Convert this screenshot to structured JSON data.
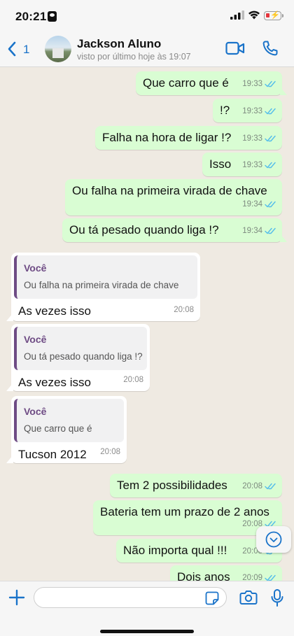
{
  "status_bar": {
    "time": "20:21"
  },
  "header": {
    "back_count": "1",
    "contact_name": "Jackson Aluno",
    "contact_status": "visto por último hoje às 19:07"
  },
  "messages": [
    {
      "text": "Que carro que é",
      "time": "19:33",
      "outgoing": true,
      "read": true
    },
    {
      "text": "!?",
      "time": "19:33",
      "outgoing": true,
      "read": true
    },
    {
      "text": "Falha na hora de ligar !?",
      "time": "19:33",
      "outgoing": true,
      "read": true
    },
    {
      "text": "Isso",
      "time": "19:33",
      "outgoing": true,
      "read": true
    },
    {
      "text": "Ou falha na primeira virada de chave",
      "time": "19:34",
      "outgoing": true,
      "read": true
    },
    {
      "text": "Ou tá pesado quando liga !?",
      "time": "19:34",
      "outgoing": true,
      "read": true
    },
    {
      "text": "As vezes isso",
      "time": "20:08",
      "outgoing": false,
      "quote": {
        "author": "Você",
        "text": "Ou falha na primeira virada de chave"
      }
    },
    {
      "text": "As vezes isso",
      "time": "20:08",
      "outgoing": false,
      "quote": {
        "author": "Você",
        "text": "Ou tá pesado quando liga !?"
      }
    },
    {
      "text": "Tucson 2012",
      "time": "20:08",
      "outgoing": false,
      "quote": {
        "author": "Você",
        "text": "Que carro que é"
      }
    },
    {
      "text": "Tem 2 possibilidades",
      "time": "20:08",
      "outgoing": true,
      "read": true
    },
    {
      "text": "Bateria tem um prazo de 2 anos",
      "time": "20:08",
      "outgoing": true,
      "read": true
    },
    {
      "text": "Não importa qual !!!",
      "time": "20:08",
      "outgoing": true,
      "read": true
    },
    {
      "text": "Dois anos",
      "time": "20:09",
      "outgoing": true,
      "read": true
    }
  ],
  "composer": {
    "placeholder": "",
    "value": ""
  },
  "colors": {
    "accent": "#1a73c9",
    "outgoing_bubble": "#d9fdd3",
    "incoming_bubble": "#ffffff",
    "quote_author": "#6e4b84",
    "read_ticks": "#53bdeb"
  },
  "icons": [
    "back-chevron",
    "video-camera",
    "phone",
    "chevron-down",
    "plus",
    "sticker",
    "camera",
    "microphone",
    "double-check"
  ]
}
